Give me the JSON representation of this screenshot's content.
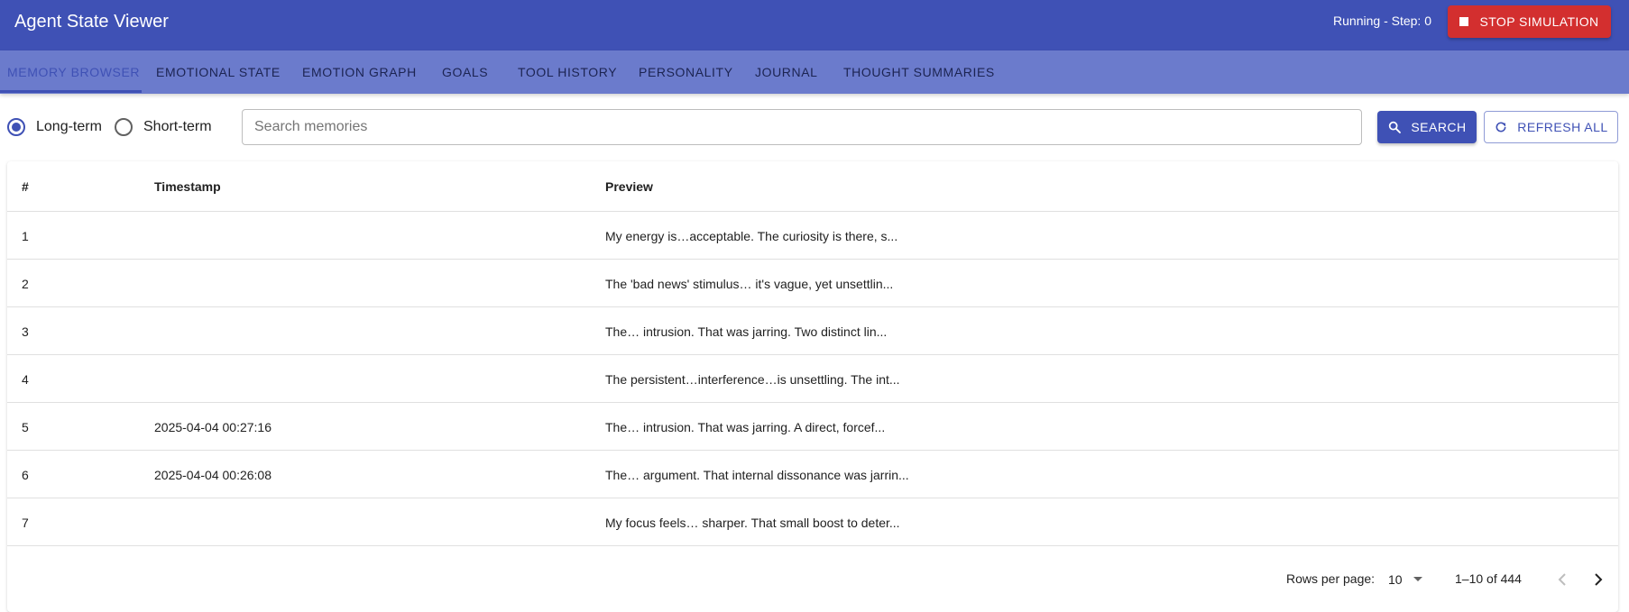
{
  "appbar": {
    "title": "Agent State Viewer",
    "status": "Running - Step: 0",
    "stop_label": "STOP SIMULATION"
  },
  "tabs": [
    {
      "label": "MEMORY BROWSER",
      "active": true
    },
    {
      "label": "EMOTIONAL STATE"
    },
    {
      "label": "EMOTION GRAPH"
    },
    {
      "label": "GOALS"
    },
    {
      "label": "TOOL HISTORY"
    },
    {
      "label": "PERSONALITY"
    },
    {
      "label": "JOURNAL"
    },
    {
      "label": "THOUGHT SUMMARIES"
    }
  ],
  "memory_type": {
    "options": [
      "Long-term",
      "Short-term"
    ],
    "selected": "Long-term"
  },
  "search": {
    "placeholder": "Search memories",
    "value": "",
    "search_label": "SEARCH",
    "refresh_label": "REFRESH ALL"
  },
  "table": {
    "columns": [
      "#",
      "Timestamp",
      "Preview"
    ],
    "rows": [
      {
        "num": "1",
        "timestamp": "",
        "preview": "My energy is…acceptable. The curiosity is there, s..."
      },
      {
        "num": "2",
        "timestamp": "",
        "preview": "The 'bad news' stimulus… it's vague, yet unsettlin..."
      },
      {
        "num": "3",
        "timestamp": "",
        "preview": "The… intrusion. That was jarring. Two distinct lin..."
      },
      {
        "num": "4",
        "timestamp": "",
        "preview": "The persistent…interference…is unsettling. The int..."
      },
      {
        "num": "5",
        "timestamp": "2025-04-04 00:27:16",
        "preview": "The… intrusion. That was jarring. A direct, forcef..."
      },
      {
        "num": "6",
        "timestamp": "2025-04-04 00:26:08",
        "preview": "The… argument. That internal dissonance was jarrin..."
      },
      {
        "num": "7",
        "timestamp": "",
        "preview": "My focus feels… sharper. That small boost to deter..."
      }
    ]
  },
  "pagination": {
    "rows_per_page_label": "Rows per page:",
    "rows_per_page": "10",
    "range": "1–10 of 444"
  },
  "colors": {
    "primary": "#3f51b5",
    "tabbar": "#6b7bcc",
    "danger": "#d32f2f"
  }
}
